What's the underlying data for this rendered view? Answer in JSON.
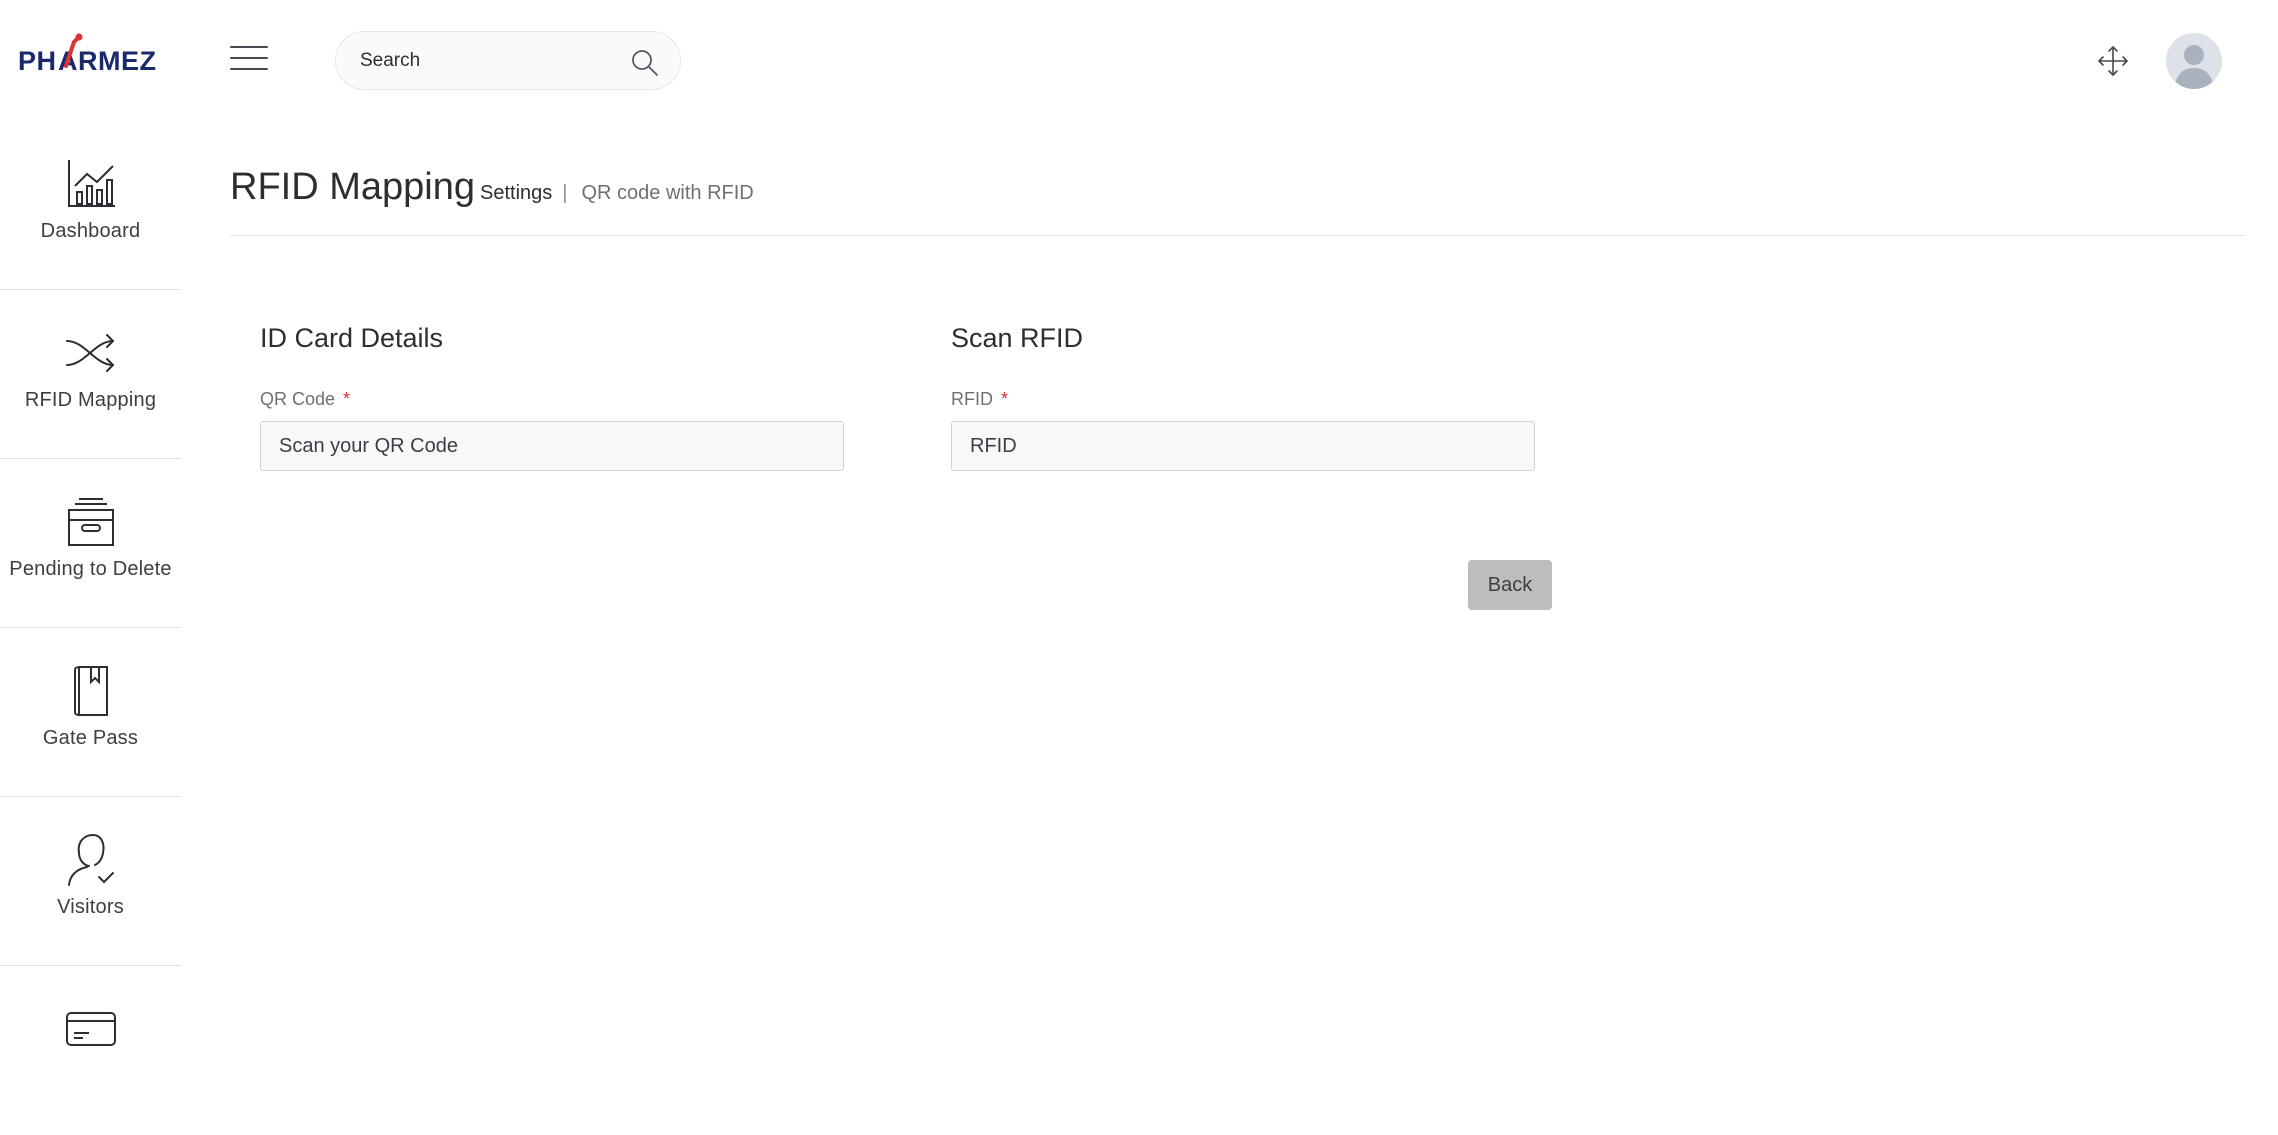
{
  "brand": {
    "name": "PHARMEZ",
    "accent": "#e03131",
    "primary": "#1b2a6b"
  },
  "sidebar": {
    "items": [
      {
        "label": "Dashboard",
        "icon": "chart-icon"
      },
      {
        "label": "RFID Mapping",
        "icon": "shuffle-icon"
      },
      {
        "label": "Pending to Delete",
        "icon": "archive-icon"
      },
      {
        "label": "Gate Pass",
        "icon": "book-icon"
      },
      {
        "label": "Visitors",
        "icon": "user-check-icon"
      },
      {
        "label": "",
        "icon": "credit-card-icon"
      }
    ]
  },
  "topbar": {
    "search_placeholder": "Search",
    "menu_icon": "hamburger-icon",
    "search_icon": "search-icon",
    "move_icon": "move-icon",
    "avatar_icon": "user-avatar-icon"
  },
  "page": {
    "title": "RFID Mapping",
    "breadcrumb_parent": "Settings",
    "breadcrumb_separator": "|",
    "breadcrumb_current": "QR code with RFID"
  },
  "form": {
    "left": {
      "section_title": "ID Card Details",
      "label": "QR Code",
      "required_mark": "*",
      "placeholder": "Scan your QR Code",
      "value": ""
    },
    "right": {
      "section_title": "Scan RFID",
      "label": "RFID",
      "required_mark": "*",
      "placeholder": "RFID",
      "value": ""
    },
    "back_label": "Back"
  }
}
